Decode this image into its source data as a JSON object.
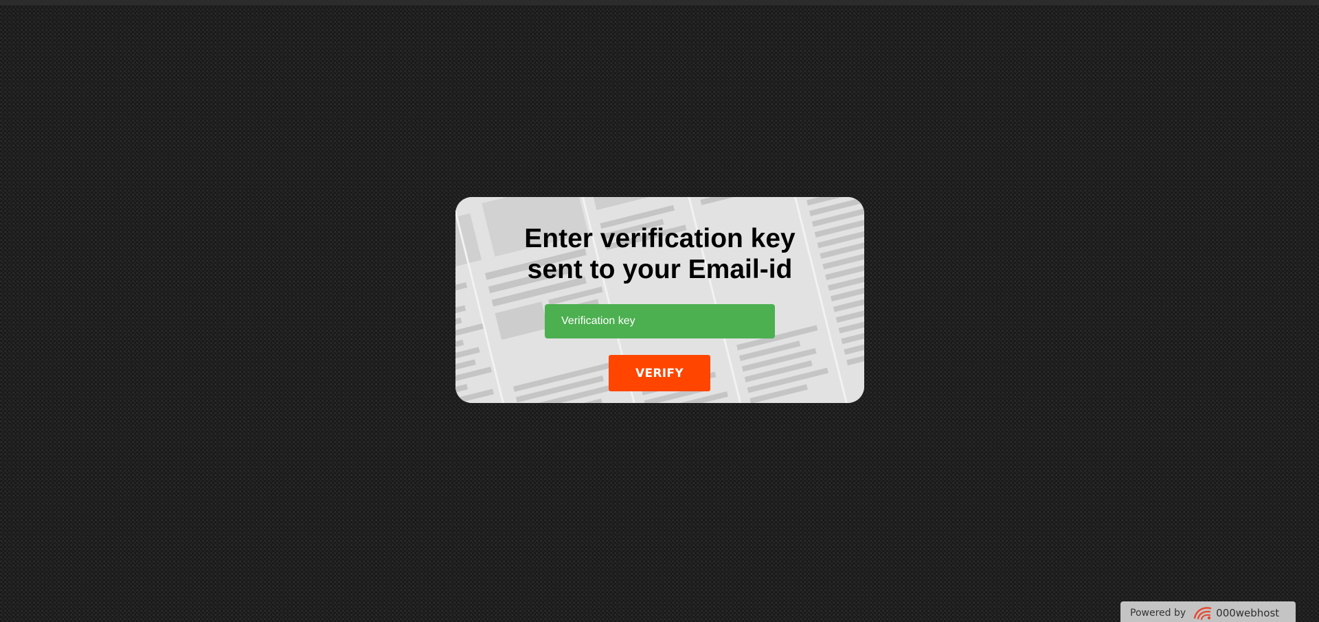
{
  "form": {
    "title_line1": "Enter verification key",
    "title_line2": "sent to your Email-id",
    "input_placeholder": "Verification key",
    "input_value": "",
    "verify_label": "VERIFY"
  },
  "footer": {
    "powered_by": "Powered by",
    "brand_name": "000webhost",
    "brand_icon": "000webhost-logo-icon"
  },
  "colors": {
    "page_background": "#232323",
    "input_background": "#4caf50",
    "button_background": "#ff4500",
    "brand_accent": "#e8442c"
  }
}
